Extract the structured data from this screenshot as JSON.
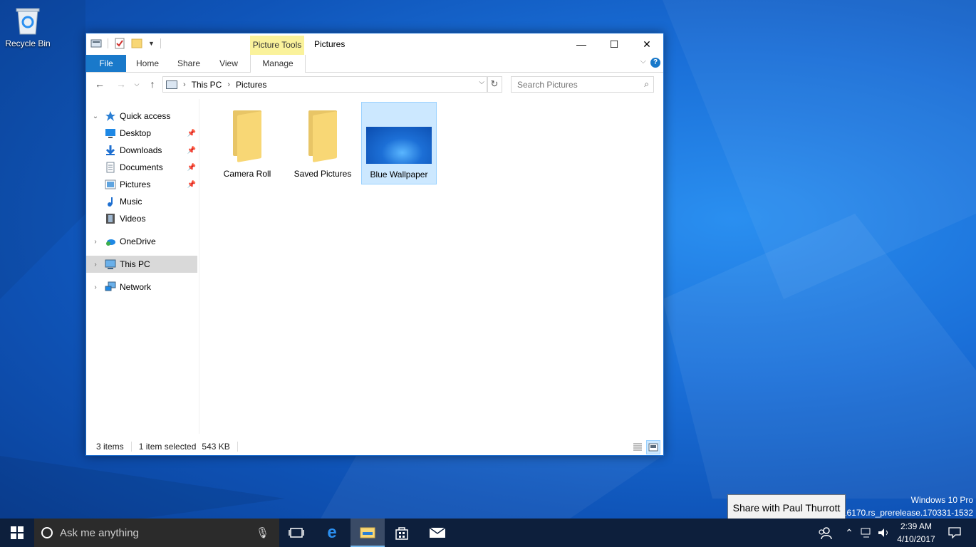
{
  "desktop": {
    "recycle_bin_label": "Recycle Bin",
    "watermark_line1": "Windows 10 Pro",
    "watermark_line2": "d 16170.rs_prerelease.170331-1532"
  },
  "explorer": {
    "title": "Pictures",
    "contextual_tab": "Picture Tools",
    "tabs": [
      "File",
      "Home",
      "Share",
      "View",
      "Manage"
    ],
    "caption": {
      "minimize": "—",
      "maximize": "☐",
      "close": "✕"
    },
    "help": "?",
    "breadcrumb": [
      "This PC",
      "Pictures"
    ],
    "search_placeholder": "Search Pictures",
    "nav": {
      "quick_access": "Quick access",
      "quick_items": [
        {
          "label": "Desktop",
          "icon": "desktop-icon",
          "pinned": true
        },
        {
          "label": "Downloads",
          "icon": "downloads-icon",
          "pinned": true
        },
        {
          "label": "Documents",
          "icon": "documents-icon",
          "pinned": true
        },
        {
          "label": "Pictures",
          "icon": "pictures-icon",
          "pinned": true
        },
        {
          "label": "Music",
          "icon": "music-icon",
          "pinned": false
        },
        {
          "label": "Videos",
          "icon": "videos-icon",
          "pinned": false
        }
      ],
      "onedrive": "OneDrive",
      "this_pc": "This PC",
      "network": "Network"
    },
    "items": [
      {
        "label": "Camera Roll",
        "type": "folder"
      },
      {
        "label": "Saved Pictures",
        "type": "folder"
      },
      {
        "label": "Blue Wallpaper",
        "type": "image",
        "selected": true
      }
    ],
    "status": {
      "count": "3 items",
      "selected": "1 item selected",
      "size": "543 KB"
    }
  },
  "tooltip": "Share with Paul Thurrott",
  "taskbar": {
    "search_placeholder": "Ask me anything",
    "clock_time": "2:39 AM",
    "clock_date": "4/10/2017",
    "accent": "#1e82d6"
  }
}
